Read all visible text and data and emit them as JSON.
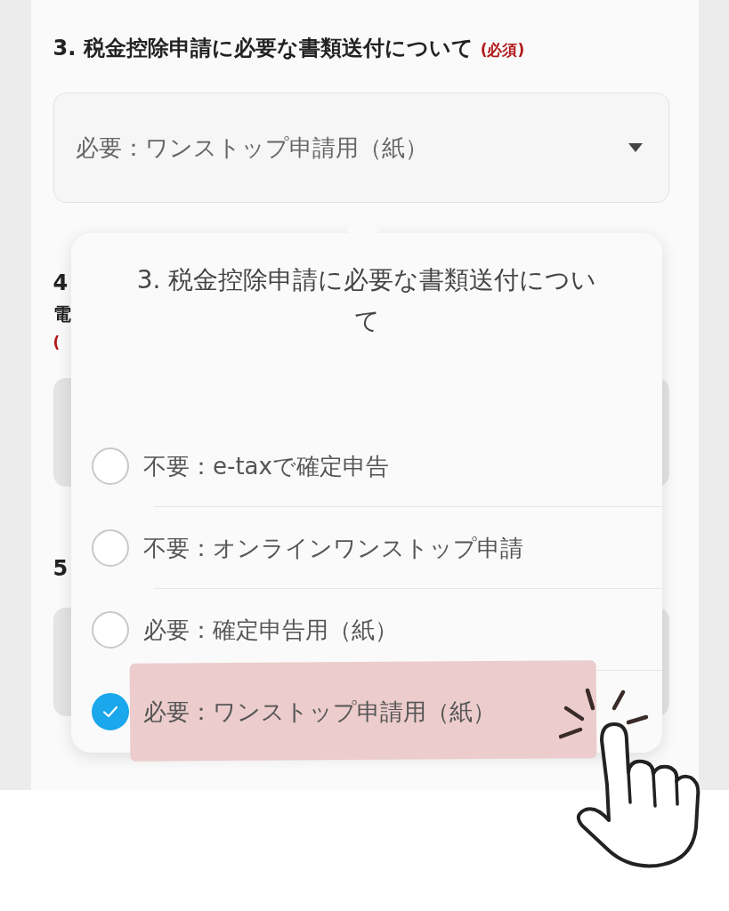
{
  "question_3": {
    "title": "3. 税金控除申請に必要な書類送付について",
    "required": "(必須)",
    "select_value": "必要：ワンストップ申請用（紙）"
  },
  "question_4": {
    "number": "4",
    "title": "電",
    "required": "("
  },
  "question_5": {
    "number": "5"
  },
  "picker": {
    "title": "3. 税金控除申請に必要な書類送付について",
    "options": [
      {
        "label": "不要：e-taxで確定申告",
        "selected": false,
        "highlighted": false
      },
      {
        "label": "不要：オンラインワンストップ申請",
        "selected": false,
        "highlighted": false
      },
      {
        "label": "必要：確定申告用（紙）",
        "selected": false,
        "highlighted": false
      },
      {
        "label": "必要：ワンストップ申請用（紙）",
        "selected": true,
        "highlighted": true
      }
    ]
  }
}
